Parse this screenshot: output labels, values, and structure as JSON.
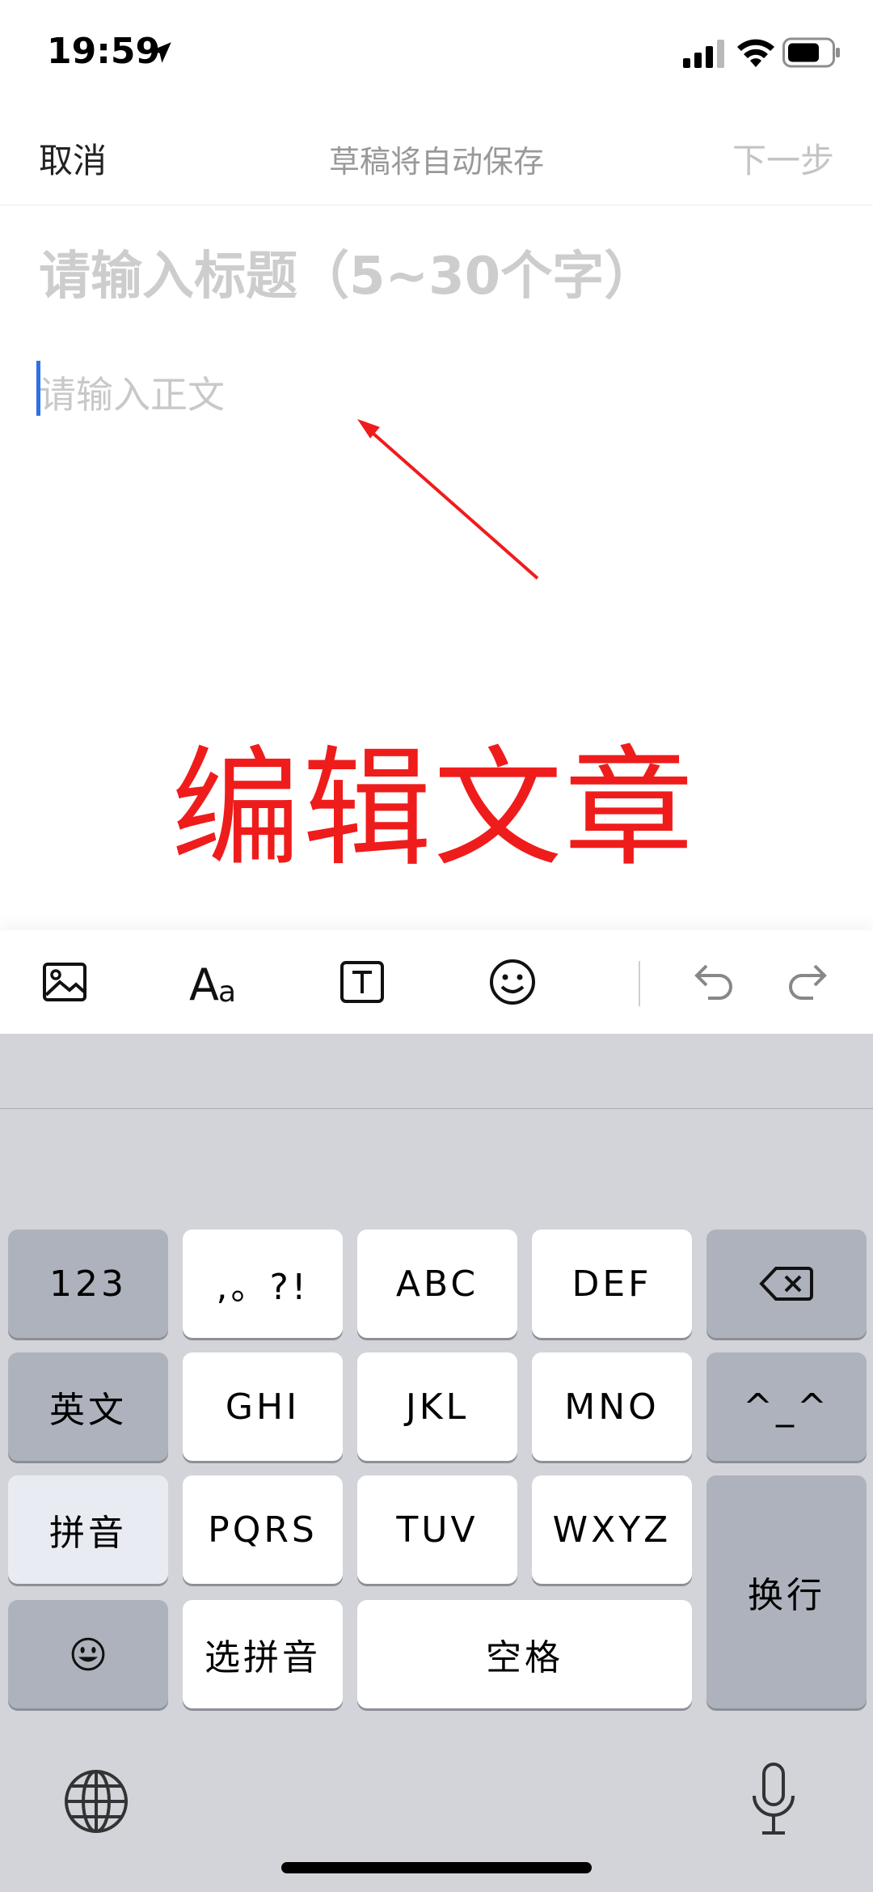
{
  "status_bar": {
    "time": "19:59"
  },
  "nav": {
    "cancel_label": "取消",
    "title": "草稿将自动保存",
    "next_label": "下一步"
  },
  "editor": {
    "title_placeholder": "请输入标题（5~30个字）",
    "body_placeholder": "请输入正文"
  },
  "annotation": {
    "text": "编辑文章",
    "color": "#ef1c1c"
  },
  "toolbar": {
    "icons": [
      "image-icon",
      "font-size-icon",
      "text-box-icon",
      "emoji-icon",
      "undo-icon",
      "redo-icon"
    ]
  },
  "keyboard": {
    "keys": {
      "num": "123",
      "punct": ",。?!",
      "abc": "ABC",
      "def": "DEF",
      "english": "英文",
      "ghi": "GHI",
      "jkl": "JKL",
      "mno": "MNO",
      "kaomoji": "^_^",
      "pinyin": "拼音",
      "pqrs": "PQRS",
      "tuv": "TUV",
      "wxyz": "WXYZ",
      "newline": "换行",
      "select_pinyin": "选拼音",
      "space": "空格"
    },
    "icons": [
      "delete-icon",
      "emoji-icon",
      "globe-icon",
      "microphone-icon"
    ]
  },
  "colors": {
    "caret": "#2f6fe8",
    "keyboard_bg": "#d2d4d9",
    "function_key": "#adb2bc"
  }
}
